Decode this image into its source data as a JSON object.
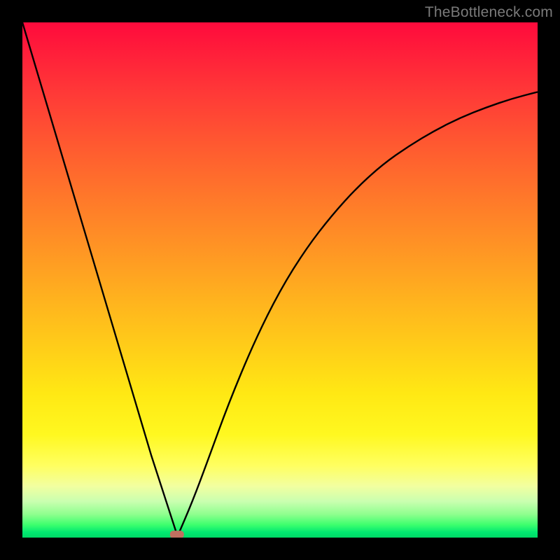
{
  "watermark": "TheBottleneck.com",
  "chart_data": {
    "type": "line",
    "title": "",
    "xlabel": "",
    "ylabel": "",
    "xlim": [
      0,
      100
    ],
    "ylim": [
      0,
      100
    ],
    "grid": false,
    "legend": false,
    "series": [
      {
        "name": "left-branch",
        "x": [
          0,
          5,
          10,
          15,
          20,
          25,
          30
        ],
        "y": [
          100,
          83.2,
          66.4,
          49.6,
          32.8,
          16.0,
          0.6
        ]
      },
      {
        "name": "right-branch",
        "x": [
          30,
          33,
          36,
          40,
          45,
          50,
          55,
          60,
          65,
          70,
          75,
          80,
          85,
          90,
          95,
          100
        ],
        "y": [
          0,
          7,
          15,
          26,
          38,
          48,
          56,
          62.5,
          68,
          72.5,
          76,
          79,
          81.5,
          83.5,
          85.2,
          86.5
        ]
      }
    ],
    "marker": {
      "x": 30,
      "y": 0.6,
      "color": "#c17060"
    },
    "background_gradient": {
      "top": "#ff0a3c",
      "mid_upper": "#ff9524",
      "mid_lower": "#fff820",
      "bottom": "#00d866"
    },
    "frame_color": "#000000",
    "curve_color": "#000000"
  }
}
